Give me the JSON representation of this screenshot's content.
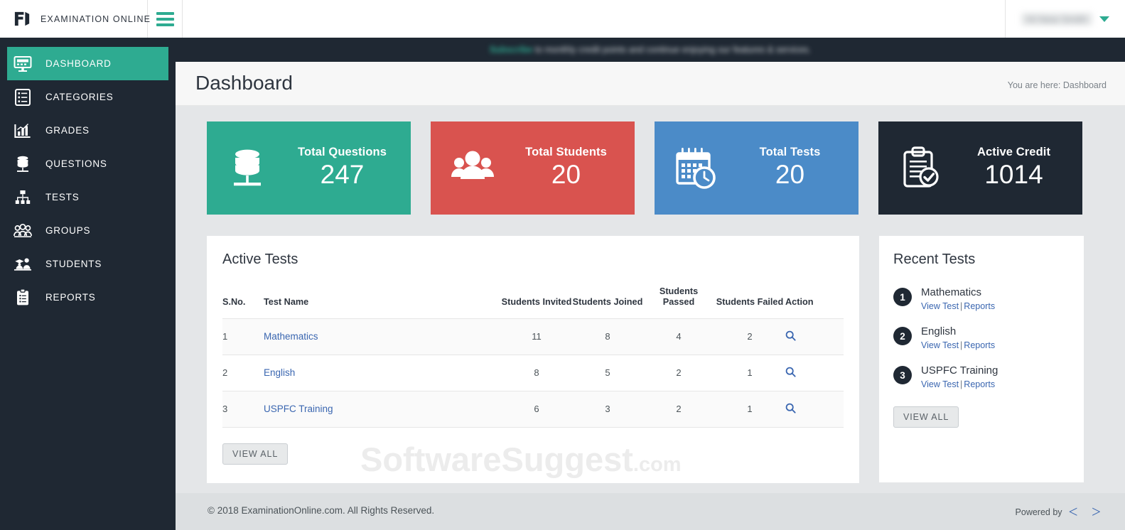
{
  "brand": {
    "name": "EXAMINATION ONLINE",
    "logo_icon": "brand-logo-icon"
  },
  "topbar": {
    "hamburger_icon": "hamburger-menu-icon",
    "user_name": "Hi New Smith",
    "caret_icon": "chevron-down-icon"
  },
  "notice": {
    "highlight": "Subscribe",
    "text": " to monthly credit points and continue enjoying our features & services."
  },
  "sidebar": {
    "items": [
      {
        "label": "DASHBOARD",
        "icon": "monitor-icon",
        "active": true
      },
      {
        "label": "CATEGORIES",
        "icon": "list-box-icon",
        "active": false
      },
      {
        "label": "GRADES",
        "icon": "bar-chart-icon",
        "active": false
      },
      {
        "label": "QUESTIONS",
        "icon": "database-icon",
        "active": false
      },
      {
        "label": "TESTS",
        "icon": "sitemap-icon",
        "active": false
      },
      {
        "label": "GROUPS",
        "icon": "people-icon",
        "active": false
      },
      {
        "label": "STUDENTS",
        "icon": "students-icon",
        "active": false
      },
      {
        "label": "REPORTS",
        "icon": "clipboard-list-icon",
        "active": false
      }
    ]
  },
  "page": {
    "title": "Dashboard",
    "breadcrumb": "You are here: Dashboard"
  },
  "cards": [
    {
      "label": "Total Questions",
      "value": "247",
      "color": "#2eab91",
      "icon": "database-icon"
    },
    {
      "label": "Total Students",
      "value": "20",
      "color": "#d9534f",
      "icon": "people-group-icon"
    },
    {
      "label": "Total Tests",
      "value": "20",
      "color": "#4b8bc8",
      "icon": "calendar-clock-icon"
    },
    {
      "label": "Active Credit",
      "value": "1014",
      "color": "#1f2833",
      "icon": "clipboard-check-icon"
    }
  ],
  "active_tests": {
    "title": "Active Tests",
    "columns": [
      "S.No.",
      "Test Name",
      "Students Invited",
      "Students Joined",
      "Students Passed",
      "Students Failed",
      "Action"
    ],
    "rows": [
      {
        "sno": "1",
        "name": "Mathematics",
        "invited": "11",
        "joined": "8",
        "passed": "4",
        "failed": "2",
        "action_icon": "magnifier-icon"
      },
      {
        "sno": "2",
        "name": "English",
        "invited": "8",
        "joined": "5",
        "passed": "2",
        "failed": "1",
        "action_icon": "magnifier-icon"
      },
      {
        "sno": "3",
        "name": "USPFC Training",
        "invited": "6",
        "joined": "3",
        "passed": "2",
        "failed": "1",
        "action_icon": "magnifier-icon"
      }
    ],
    "view_all_label": "VIEW ALL"
  },
  "recent_tests": {
    "title": "Recent Tests",
    "items": [
      {
        "num": "1",
        "name": "Mathematics",
        "view_label": "View Test",
        "reports_label": "Reports"
      },
      {
        "num": "2",
        "name": "English",
        "view_label": "View Test",
        "reports_label": "Reports"
      },
      {
        "num": "3",
        "name": "USPFC Training",
        "view_label": "View Test",
        "reports_label": "Reports"
      }
    ],
    "view_all_label": "VIEW ALL"
  },
  "watermark": {
    "main": "SoftwareSuggest",
    "suffix": ".com"
  },
  "footer": {
    "copyright": "© 2018 ExaminationOnline.com. All Rights Reserved.",
    "powered_label": "Powered by",
    "powered_logo": "< 𝒼 >"
  },
  "colors": {
    "accent": "#2eab91",
    "dark": "#1f2833",
    "link": "#3a66b0",
    "page_bg": "#e4e6e8"
  }
}
